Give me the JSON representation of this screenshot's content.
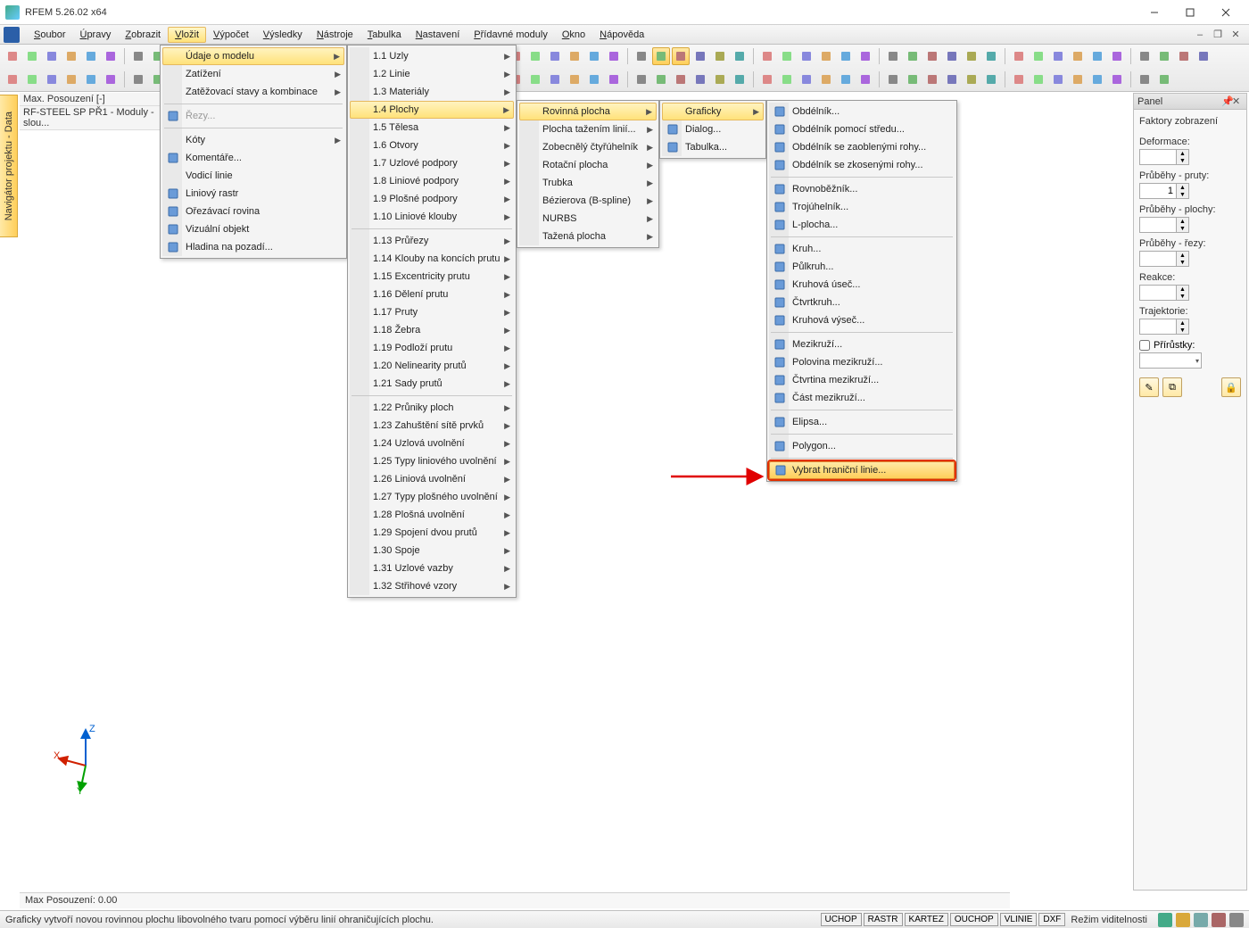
{
  "title": "RFEM 5.26.02 x64",
  "menubar": [
    "Soubor",
    "Úpravy",
    "Zobrazit",
    "Vložit",
    "Výpočet",
    "Výsledky",
    "Nástroje",
    "Tabulka",
    "Nastavení",
    "Přídavné moduly",
    "Okno",
    "Nápověda"
  ],
  "menubar_active_index": 3,
  "left_tab": "Navigátor projektu - Data",
  "ws_line1": "Max. Posouzení [-]",
  "ws_line2": "RF-STEEL SP PŘ1 - Moduly - slou...",
  "status_line1": "Max Posouzení: 0.00",
  "status_hint": "Graficky vytvoří novou rovinnou plochu libovolného tvaru pomocí výběru linií ohraničujících plochu.",
  "status_chips": [
    "UCHOP",
    "RASTR",
    "KARTEZ",
    "OUCHOP",
    "VLINIE",
    "DXF"
  ],
  "status_mode": "Režim viditelnosti",
  "panel": {
    "title": "Panel",
    "group": "Faktory zobrazení",
    "labels": [
      "Deformace:",
      "Průběhy - pruty:",
      "Průběhy - plochy:",
      "Průběhy - řezy:",
      "Reakce:",
      "Trajektorie:"
    ],
    "pruty_value": "1",
    "chk_label": "Přírůstky:"
  },
  "menu1": [
    {
      "t": "Údaje o modelu",
      "hl": true,
      "arr": true
    },
    {
      "t": "Zatížení",
      "arr": true
    },
    {
      "t": "Zatěžovací stavy a kombinace",
      "arr": true
    },
    {
      "sep": true
    },
    {
      "t": "Řezy...",
      "dis": true,
      "ico": "cut"
    },
    {
      "sep": true
    },
    {
      "t": "Kóty",
      "arr": true
    },
    {
      "t": "Komentáře...",
      "ico": "comment"
    },
    {
      "t": "Vodicí linie"
    },
    {
      "t": "Liniový rastr",
      "ico": "grid"
    },
    {
      "t": "Ořezávací rovina",
      "ico": "clip"
    },
    {
      "t": "Vizuální objekt",
      "ico": "eye"
    },
    {
      "t": "Hladina na pozadí...",
      "ico": "layer"
    }
  ],
  "menu2": [
    {
      "t": "1.1 Uzly",
      "arr": true
    },
    {
      "t": "1.2 Linie",
      "arr": true
    },
    {
      "t": "1.3 Materiály",
      "arr": true
    },
    {
      "t": "1.4 Plochy",
      "hl": true,
      "arr": true
    },
    {
      "t": "1.5 Tělesa",
      "arr": true
    },
    {
      "t": "1.6 Otvory",
      "arr": true
    },
    {
      "t": "1.7 Uzlové podpory",
      "arr": true
    },
    {
      "t": "1.8 Liniové podpory",
      "arr": true
    },
    {
      "t": "1.9 Plošné podpory",
      "arr": true
    },
    {
      "t": "1.10 Liniové klouby",
      "arr": true
    },
    {
      "sep": true
    },
    {
      "t": "1.13 Průřezy",
      "arr": true
    },
    {
      "t": "1.14 Klouby na koncích prutu",
      "arr": true
    },
    {
      "t": "1.15 Excentricity prutu",
      "arr": true
    },
    {
      "t": "1.16 Dělení prutu",
      "arr": true
    },
    {
      "t": "1.17 Pruty",
      "arr": true
    },
    {
      "t": "1.18 Žebra",
      "arr": true
    },
    {
      "t": "1.19 Podloží prutu",
      "arr": true
    },
    {
      "t": "1.20 Nelinearity prutů",
      "arr": true
    },
    {
      "t": "1.21 Sady prutů",
      "arr": true
    },
    {
      "sep": true
    },
    {
      "t": "1.22 Průniky ploch",
      "arr": true
    },
    {
      "t": "1.23 Zahuštění sítě prvků",
      "arr": true
    },
    {
      "t": "1.24 Uzlová uvolnění",
      "arr": true
    },
    {
      "t": "1.25 Typy liniového uvolnění",
      "arr": true
    },
    {
      "t": "1.26 Liniová uvolnění",
      "arr": true
    },
    {
      "t": "1.27 Typy plošného uvolnění",
      "arr": true
    },
    {
      "t": "1.28 Plošná uvolnění",
      "arr": true
    },
    {
      "t": "1.29 Spojení dvou prutů",
      "arr": true
    },
    {
      "t": "1.30 Spoje",
      "arr": true
    },
    {
      "t": "1.31 Uzlové vazby",
      "arr": true
    },
    {
      "t": "1.32 Střihové vzory",
      "arr": true
    }
  ],
  "menu3": [
    {
      "t": "Rovinná plocha",
      "hl": true,
      "arr": true
    },
    {
      "t": "Plocha tažením linií...",
      "arr": true
    },
    {
      "t": "Zobecnělý čtyřúhelník",
      "arr": true
    },
    {
      "t": "Rotační plocha",
      "arr": true
    },
    {
      "t": "Trubka",
      "arr": true
    },
    {
      "t": "Bézierova (B-spline)",
      "arr": true
    },
    {
      "t": "NURBS",
      "arr": true
    },
    {
      "t": "Tažená plocha",
      "arr": true
    }
  ],
  "menu4": [
    {
      "t": "Graficky",
      "hl": true,
      "arr": true
    },
    {
      "t": "Dialog...",
      "ico": "dlg"
    },
    {
      "t": "Tabulka...",
      "ico": "tbl"
    }
  ],
  "menu5": [
    {
      "t": "Obdélník...",
      "ico": "s"
    },
    {
      "t": "Obdélník pomocí středu...",
      "ico": "s"
    },
    {
      "t": "Obdélník se zaoblenými rohy...",
      "ico": "s"
    },
    {
      "t": "Obdélník se zkosenými rohy...",
      "ico": "s"
    },
    {
      "sep": true
    },
    {
      "t": "Rovnoběžník...",
      "ico": "s"
    },
    {
      "t": "Trojúhelník...",
      "ico": "s"
    },
    {
      "t": "L-plocha...",
      "ico": "s"
    },
    {
      "sep": true
    },
    {
      "t": "Kruh...",
      "ico": "s"
    },
    {
      "t": "Půlkruh...",
      "ico": "s"
    },
    {
      "t": "Kruhová úseč...",
      "ico": "s"
    },
    {
      "t": "Čtvrtkruh...",
      "ico": "s"
    },
    {
      "t": "Kruhová výseč...",
      "ico": "s"
    },
    {
      "sep": true
    },
    {
      "t": "Mezikruží...",
      "ico": "s"
    },
    {
      "t": "Polovina mezikruží...",
      "ico": "s"
    },
    {
      "t": "Čtvrtina mezikruží...",
      "ico": "s"
    },
    {
      "t": "Část mezikruží...",
      "ico": "s"
    },
    {
      "sep": true
    },
    {
      "t": "Elipsa...",
      "ico": "s"
    },
    {
      "sep": true
    },
    {
      "t": "Polygon...",
      "ico": "s"
    },
    {
      "sep": true
    },
    {
      "t": "Vybrat hraniční linie...",
      "ico": "s",
      "target": true
    }
  ]
}
